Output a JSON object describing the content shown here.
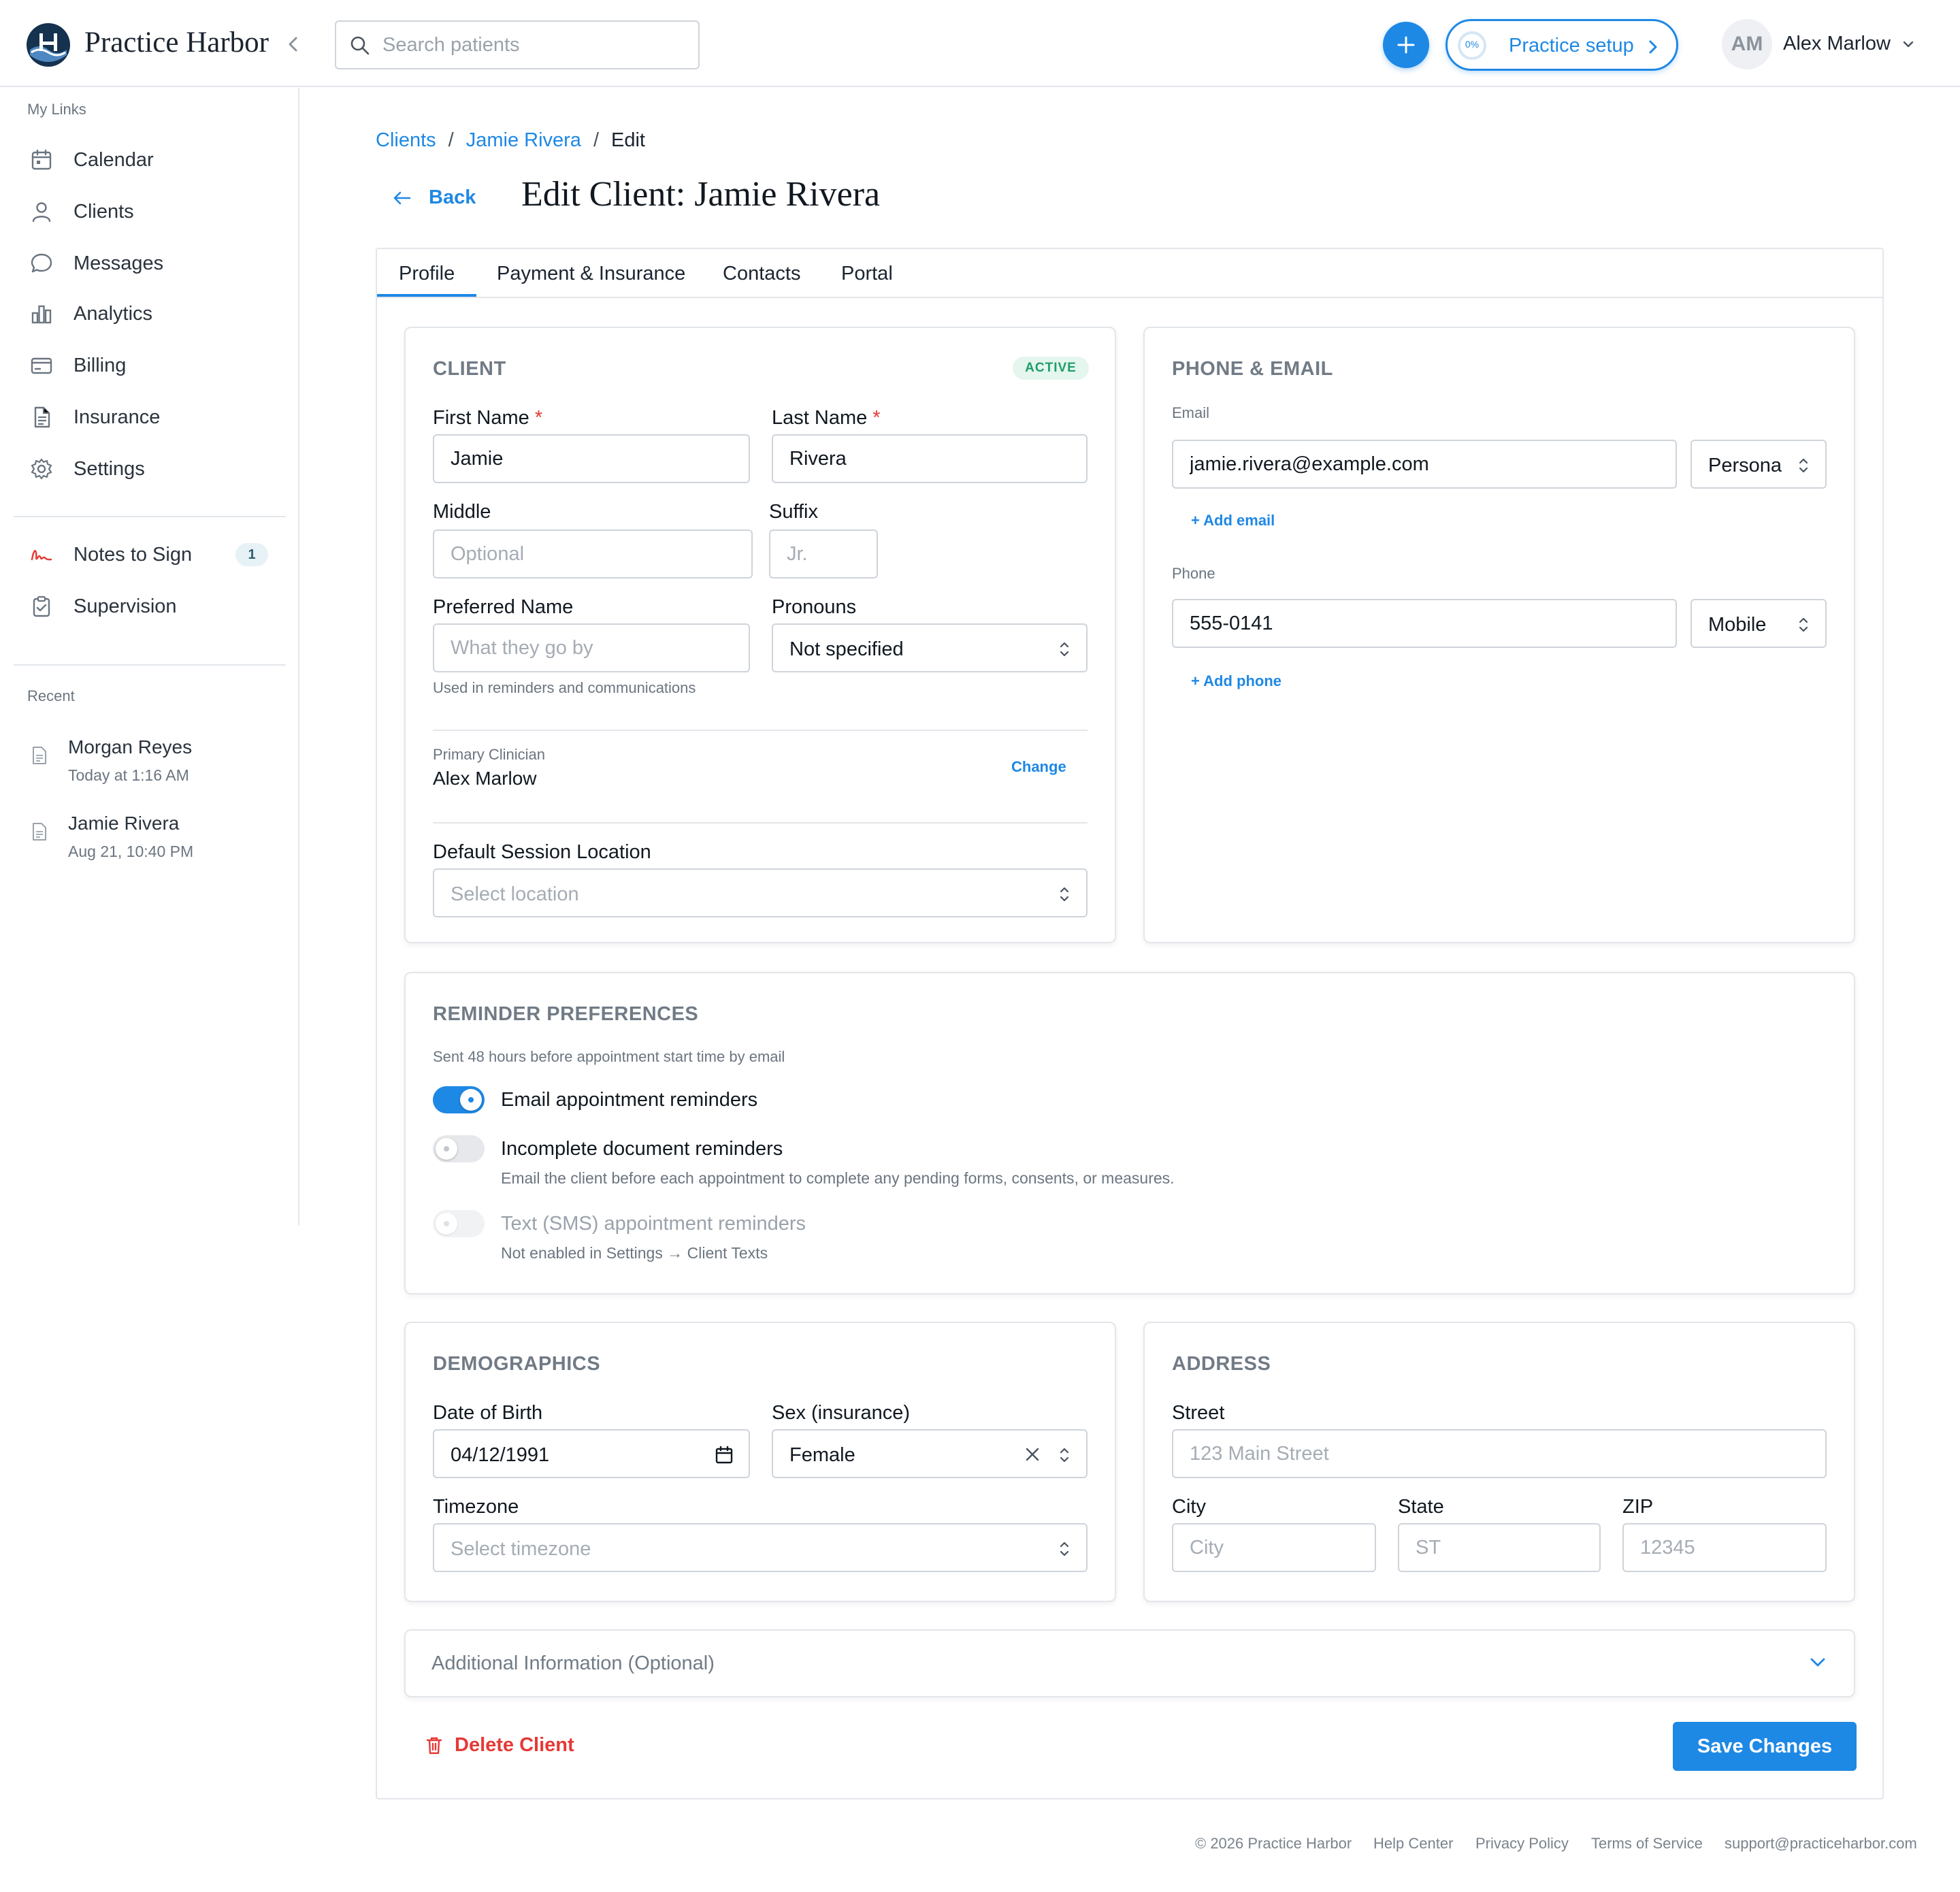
{
  "app": {
    "brand": "Practice Harbor"
  },
  "colors": {
    "accent": "#1e88e5",
    "danger": "#e53935",
    "active_badge": "#1f9d6a",
    "muted": "#717b86"
  },
  "topbar": {
    "search_placeholder": "Search patients",
    "setup_label": "Practice setup",
    "setup_progress": "0%",
    "setup_progress_fraction": 0,
    "avatar_initials": "AM",
    "user_name": "Alex Marlow"
  },
  "sidebar": {
    "my_links_heading": "My Links",
    "items": [
      {
        "label": "Calendar",
        "icon": "calendar-icon"
      },
      {
        "label": "Clients",
        "icon": "user-icon"
      },
      {
        "label": "Messages",
        "icon": "chat-icon"
      },
      {
        "label": "Analytics",
        "icon": "bar-chart-icon"
      },
      {
        "label": "Billing",
        "icon": "card-icon"
      },
      {
        "label": "Insurance",
        "icon": "document-icon"
      },
      {
        "label": "Settings",
        "icon": "gear-icon"
      }
    ],
    "secondary": [
      {
        "label": "Notes to Sign",
        "icon": "signature-icon",
        "count": "1"
      },
      {
        "label": "Supervision",
        "icon": "clipboard-check-icon"
      }
    ],
    "recent_heading": "Recent",
    "recent": [
      {
        "name": "Morgan Reyes",
        "time": "Today at 1:16 AM"
      },
      {
        "name": "Jamie Rivera",
        "time": "Aug 21, 10:40 PM"
      }
    ]
  },
  "breadcrumb": {
    "root": "Clients",
    "client": "Jamie Rivera",
    "current": "Edit"
  },
  "header": {
    "back_label": "Back",
    "title": "Edit Client: Jamie Rivera"
  },
  "tabs": [
    "Profile",
    "Payment & Insurance",
    "Contacts",
    "Portal"
  ],
  "client_card": {
    "title": "CLIENT",
    "status": "ACTIVE",
    "first_name_label": "First Name",
    "first_name": "Jamie",
    "last_name_label": "Last Name",
    "last_name": "Rivera",
    "required_mark": "*",
    "middle_label": "Middle",
    "middle_placeholder": "Optional",
    "suffix_label": "Suffix",
    "suffix_placeholder": "Jr.",
    "preferred_label": "Preferred Name",
    "preferred_placeholder": "What they go by",
    "preferred_help": "Used in reminders and communications",
    "pronouns_label": "Pronouns",
    "pronouns_value": "Not specified",
    "clinician_label": "Primary Clinician",
    "clinician_name": "Alex Marlow",
    "change_label": "Change",
    "location_label": "Default Session Location",
    "location_placeholder": "Select location"
  },
  "contact_card": {
    "title": "PHONE & EMAIL",
    "email_label": "Email",
    "email_value": "jamie.rivera@example.com",
    "email_type": "Persona",
    "add_email": "+ Add email",
    "phone_label": "Phone",
    "phone_value": "555-0141",
    "phone_type": "Mobile",
    "add_phone": "+ Add phone"
  },
  "reminders": {
    "title": "REMINDER PREFERENCES",
    "subtitle": "Sent 48 hours before appointment start time by email",
    "email_label": "Email appointment reminders",
    "email_on": true,
    "incomplete_label": "Incomplete document reminders",
    "incomplete_on": false,
    "incomplete_help": "Email the client before each appointment to complete any pending forms, consents, or measures.",
    "sms_label": "Text (SMS) appointment reminders",
    "sms_on": false,
    "sms_help": "Not enabled in Settings → Client Texts"
  },
  "demographics": {
    "title": "DEMOGRAPHICS",
    "dob_label": "Date of Birth",
    "dob_value": "04/12/1991",
    "sex_label": "Sex (insurance)",
    "sex_value": "Female",
    "timezone_label": "Timezone",
    "timezone_placeholder": "Select timezone"
  },
  "address": {
    "title": "ADDRESS",
    "street_label": "Street",
    "street_placeholder": "123 Main Street",
    "city_label": "City",
    "city_placeholder": "City",
    "state_label": "State",
    "state_placeholder": "ST",
    "zip_label": "ZIP",
    "zip_placeholder": "12345"
  },
  "additional": {
    "label": "Additional Information (Optional)"
  },
  "actions": {
    "delete_label": "Delete Client",
    "save_label": "Save Changes"
  },
  "footer": {
    "copyright": "© 2026 Practice Harbor",
    "links": [
      "Help Center",
      "Privacy Policy",
      "Terms of Service",
      "support@practiceharbor.com"
    ]
  }
}
